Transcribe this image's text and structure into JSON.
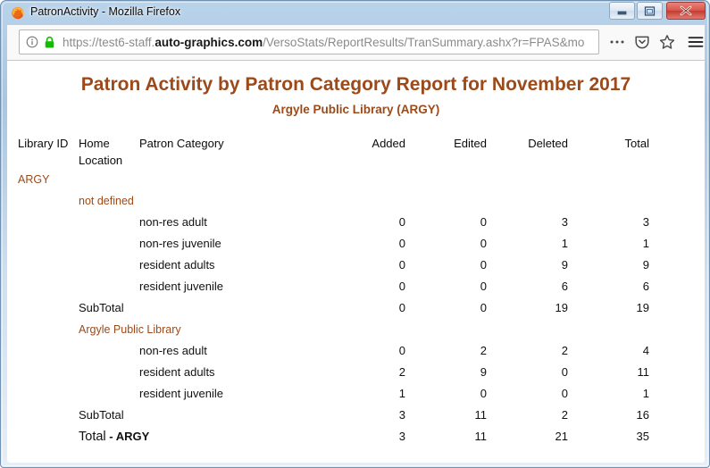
{
  "window": {
    "title": "PatronActivity - Mozilla Firefox",
    "favicon": "firefox-logo-icon",
    "buttons": {
      "minimize": "minimize-button",
      "maximize": "restore-button",
      "close": "close-button"
    }
  },
  "browser": {
    "url_prefix": "https://test6-staff.",
    "url_domain": "auto-graphics.com",
    "url_suffix": "/VersoStats/ReportResults/TranSummary.ashx?r=FPAS&mo",
    "url_full": "https://test6-staff.auto-graphics.com/VersoStats/ReportResults/TranSummary.ashx?r=FPAS&mo",
    "placeholder": "Search or enter address",
    "icons": {
      "identity": "info-circle-icon",
      "secure": "padlock-icon",
      "page_actions": "ellipsis-icon",
      "pocket": "pocket-icon",
      "bookmark": "star-icon",
      "menu": "hamburger-menu-icon"
    }
  },
  "report": {
    "title": "Patron Activity by Patron Category Report for November 2017",
    "subtitle": "Argyle Public Library (ARGY)",
    "accent_color": "#9c4a1a",
    "columns": [
      "Library ID",
      "Home Location",
      "Patron Category",
      "Added",
      "Edited",
      "Deleted",
      "Total"
    ],
    "library_id": "ARGY",
    "groups": [
      {
        "home_location": "not defined",
        "rows": [
          {
            "category": "non-res adult",
            "added": "0",
            "edited": "0",
            "deleted": "3",
            "total": "3"
          },
          {
            "category": "non-res juvenile",
            "added": "0",
            "edited": "0",
            "deleted": "1",
            "total": "1"
          },
          {
            "category": "resident adults",
            "added": "0",
            "edited": "0",
            "deleted": "9",
            "total": "9"
          },
          {
            "category": "resident juvenile",
            "added": "0",
            "edited": "0",
            "deleted": "6",
            "total": "6"
          }
        ],
        "subtotal": {
          "label": "SubTotal",
          "added": "0",
          "edited": "0",
          "deleted": "19",
          "total": "19"
        }
      },
      {
        "home_location": "Argyle Public Library",
        "rows": [
          {
            "category": "non-res adult",
            "added": "0",
            "edited": "2",
            "deleted": "2",
            "total": "4"
          },
          {
            "category": "resident adults",
            "added": "2",
            "edited": "9",
            "deleted": "0",
            "total": "11"
          },
          {
            "category": "resident juvenile",
            "added": "1",
            "edited": "0",
            "deleted": "0",
            "total": "1"
          }
        ],
        "subtotal": {
          "label": "SubTotal",
          "added": "3",
          "edited": "11",
          "deleted": "2",
          "total": "16"
        }
      }
    ],
    "grand_total": {
      "label": "Total",
      "suffix": " - ARGY",
      "added": "3",
      "edited": "11",
      "deleted": "21",
      "total": "35"
    }
  }
}
